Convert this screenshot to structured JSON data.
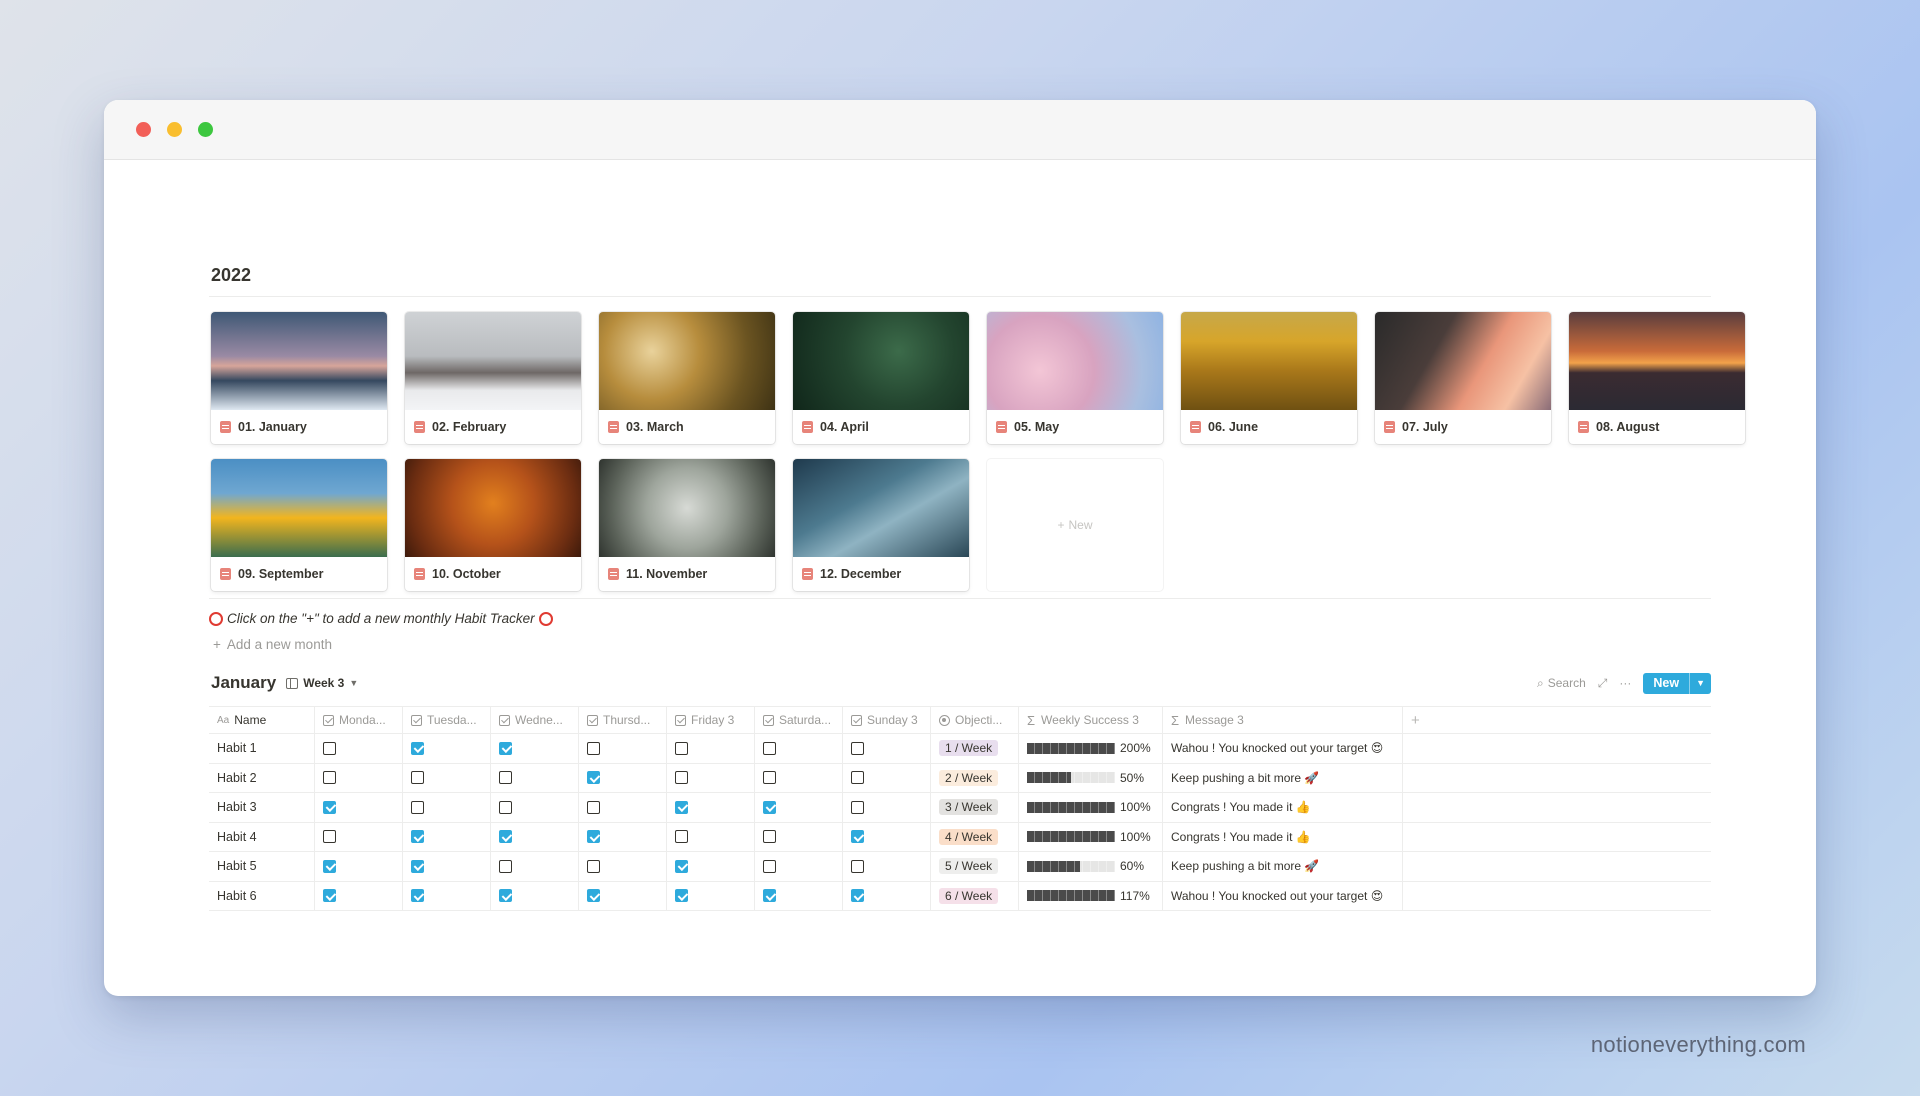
{
  "section_title": "2022",
  "months": [
    {
      "label": "01. January",
      "image": "snowy-pine-forest-dusk",
      "gradient": "linear-gradient(180deg,#3f5875 0%,#9a8aa4 45%,#d7a59a 55%,#35485f 70%,#dfe8f1 100%)"
    },
    {
      "label": "02. February",
      "image": "snowy-cabin-fog",
      "gradient": "linear-gradient(180deg,#cfd2d5 0%,#b9bcbf 45%,#6e6866 62%,#e9eaec 80%,#f3f4f6 100%)"
    },
    {
      "label": "03. March",
      "image": "golden-leaves",
      "gradient": "radial-gradient(circle at 30% 40%,#e9d29b 0%,#b78d3d 35%,#6b5421 70%,#3e3214 100%)"
    },
    {
      "label": "04. April",
      "image": "green-leaves-dew",
      "gradient": "radial-gradient(circle at 60% 40%,#3c6b4a 0%,#23452f 45%,#10261a 100%)"
    },
    {
      "label": "05. May",
      "image": "cherry-blossom",
      "gradient": "radial-gradient(circle at 30% 60%,#f3c6d6 0%,#d8a3c0 40%,#a9bfe0 75%,#8fb3e2 100%)"
    },
    {
      "label": "06. June",
      "image": "sunflower-field",
      "gradient": "linear-gradient(180deg,#c6a84a 0%,#d7a52a 30%,#a9781a 60%,#6f5112 100%)"
    },
    {
      "label": "07. July",
      "image": "palm-sunset-clouds",
      "gradient": "linear-gradient(120deg,#2a2a2a 0%,#4a3d3a 35%,#e9967a 60%,#f6c1a4 80%,#8a6c77 100%)"
    },
    {
      "label": "08. August",
      "image": "ocean-sunset",
      "gradient": "linear-gradient(180deg,#5a3d3e 0%,#c96b3a 40%,#f3a24a 52%,#3b2b31 62%,#2b2a33 100%)"
    },
    {
      "label": "09. September",
      "image": "yellow-poppies",
      "gradient": "linear-gradient(180deg,#4b8fc4 0%,#6fa7d1 35%,#f2b51e 60%,#3b6d4e 100%)"
    },
    {
      "label": "10. October",
      "image": "autumn-forest",
      "gradient": "radial-gradient(circle at 50% 45%,#e2801e 0%,#b5521a 40%,#6a2c11 80%,#3d1a0b 100%)"
    },
    {
      "label": "11. November",
      "image": "frosted-leaves",
      "gradient": "radial-gradient(circle at 50% 50%,#d7dad5 0%,#9ea59c 40%,#5b6259 75%,#2f342f 100%)"
    },
    {
      "label": "12. December",
      "image": "blue-spruce",
      "gradient": "linear-gradient(150deg,#1f3a4d 0%,#4d7a8f 40%,#8fb3c2 60%,#2a4756 100%)"
    }
  ],
  "new_card_label": "New",
  "hint_text": "Click on the \"+\" to add a new monthly Habit Tracker",
  "add_month_label": "Add a new month",
  "database": {
    "title": "January",
    "view": "Week 3",
    "search_label": "Search",
    "new_button": "New",
    "columns": [
      "Name",
      "Monda...",
      "Tuesda...",
      "Wedne...",
      "Thursd...",
      "Friday 3",
      "Saturda...",
      "Sunday 3",
      "Objecti...",
      "Weekly Success 3",
      "Message 3"
    ],
    "rows": [
      {
        "name": "Habit 1",
        "days": [
          false,
          true,
          true,
          false,
          false,
          false,
          false
        ],
        "objective": "1 / Week",
        "tag_color": "#e8deee",
        "success": 2.0,
        "success_label": "200%",
        "message": "Wahou ! You knocked out your target 😍"
      },
      {
        "name": "Habit 2",
        "days": [
          false,
          false,
          false,
          true,
          false,
          false,
          false
        ],
        "objective": "2 / Week",
        "tag_color": "#fbecdd",
        "success": 0.5,
        "success_label": "50%",
        "message": "Keep pushing a bit more 🚀"
      },
      {
        "name": "Habit 3",
        "days": [
          true,
          false,
          false,
          false,
          true,
          true,
          false
        ],
        "objective": "3 / Week",
        "tag_color": "#e3e2e0",
        "success": 1.0,
        "success_label": "100%",
        "message": "Congrats ! You made it 👍"
      },
      {
        "name": "Habit 4",
        "days": [
          false,
          true,
          true,
          true,
          false,
          false,
          true
        ],
        "objective": "4 / Week",
        "tag_color": "#fadec9",
        "success": 1.0,
        "success_label": "100%",
        "message": "Congrats ! You made it 👍"
      },
      {
        "name": "Habit 5",
        "days": [
          true,
          true,
          false,
          false,
          true,
          false,
          false
        ],
        "objective": "5 / Week",
        "tag_color": "#eeeeed",
        "success": 0.6,
        "success_label": "60%",
        "message": "Keep pushing a bit more 🚀"
      },
      {
        "name": "Habit 6",
        "days": [
          true,
          true,
          true,
          true,
          true,
          true,
          true
        ],
        "objective": "6 / Week",
        "tag_color": "#f5e0e9",
        "success": 1.17,
        "success_label": "117%",
        "message": "Wahou ! You knocked out your target 😍"
      }
    ]
  },
  "watermark": "notioneverything.com"
}
